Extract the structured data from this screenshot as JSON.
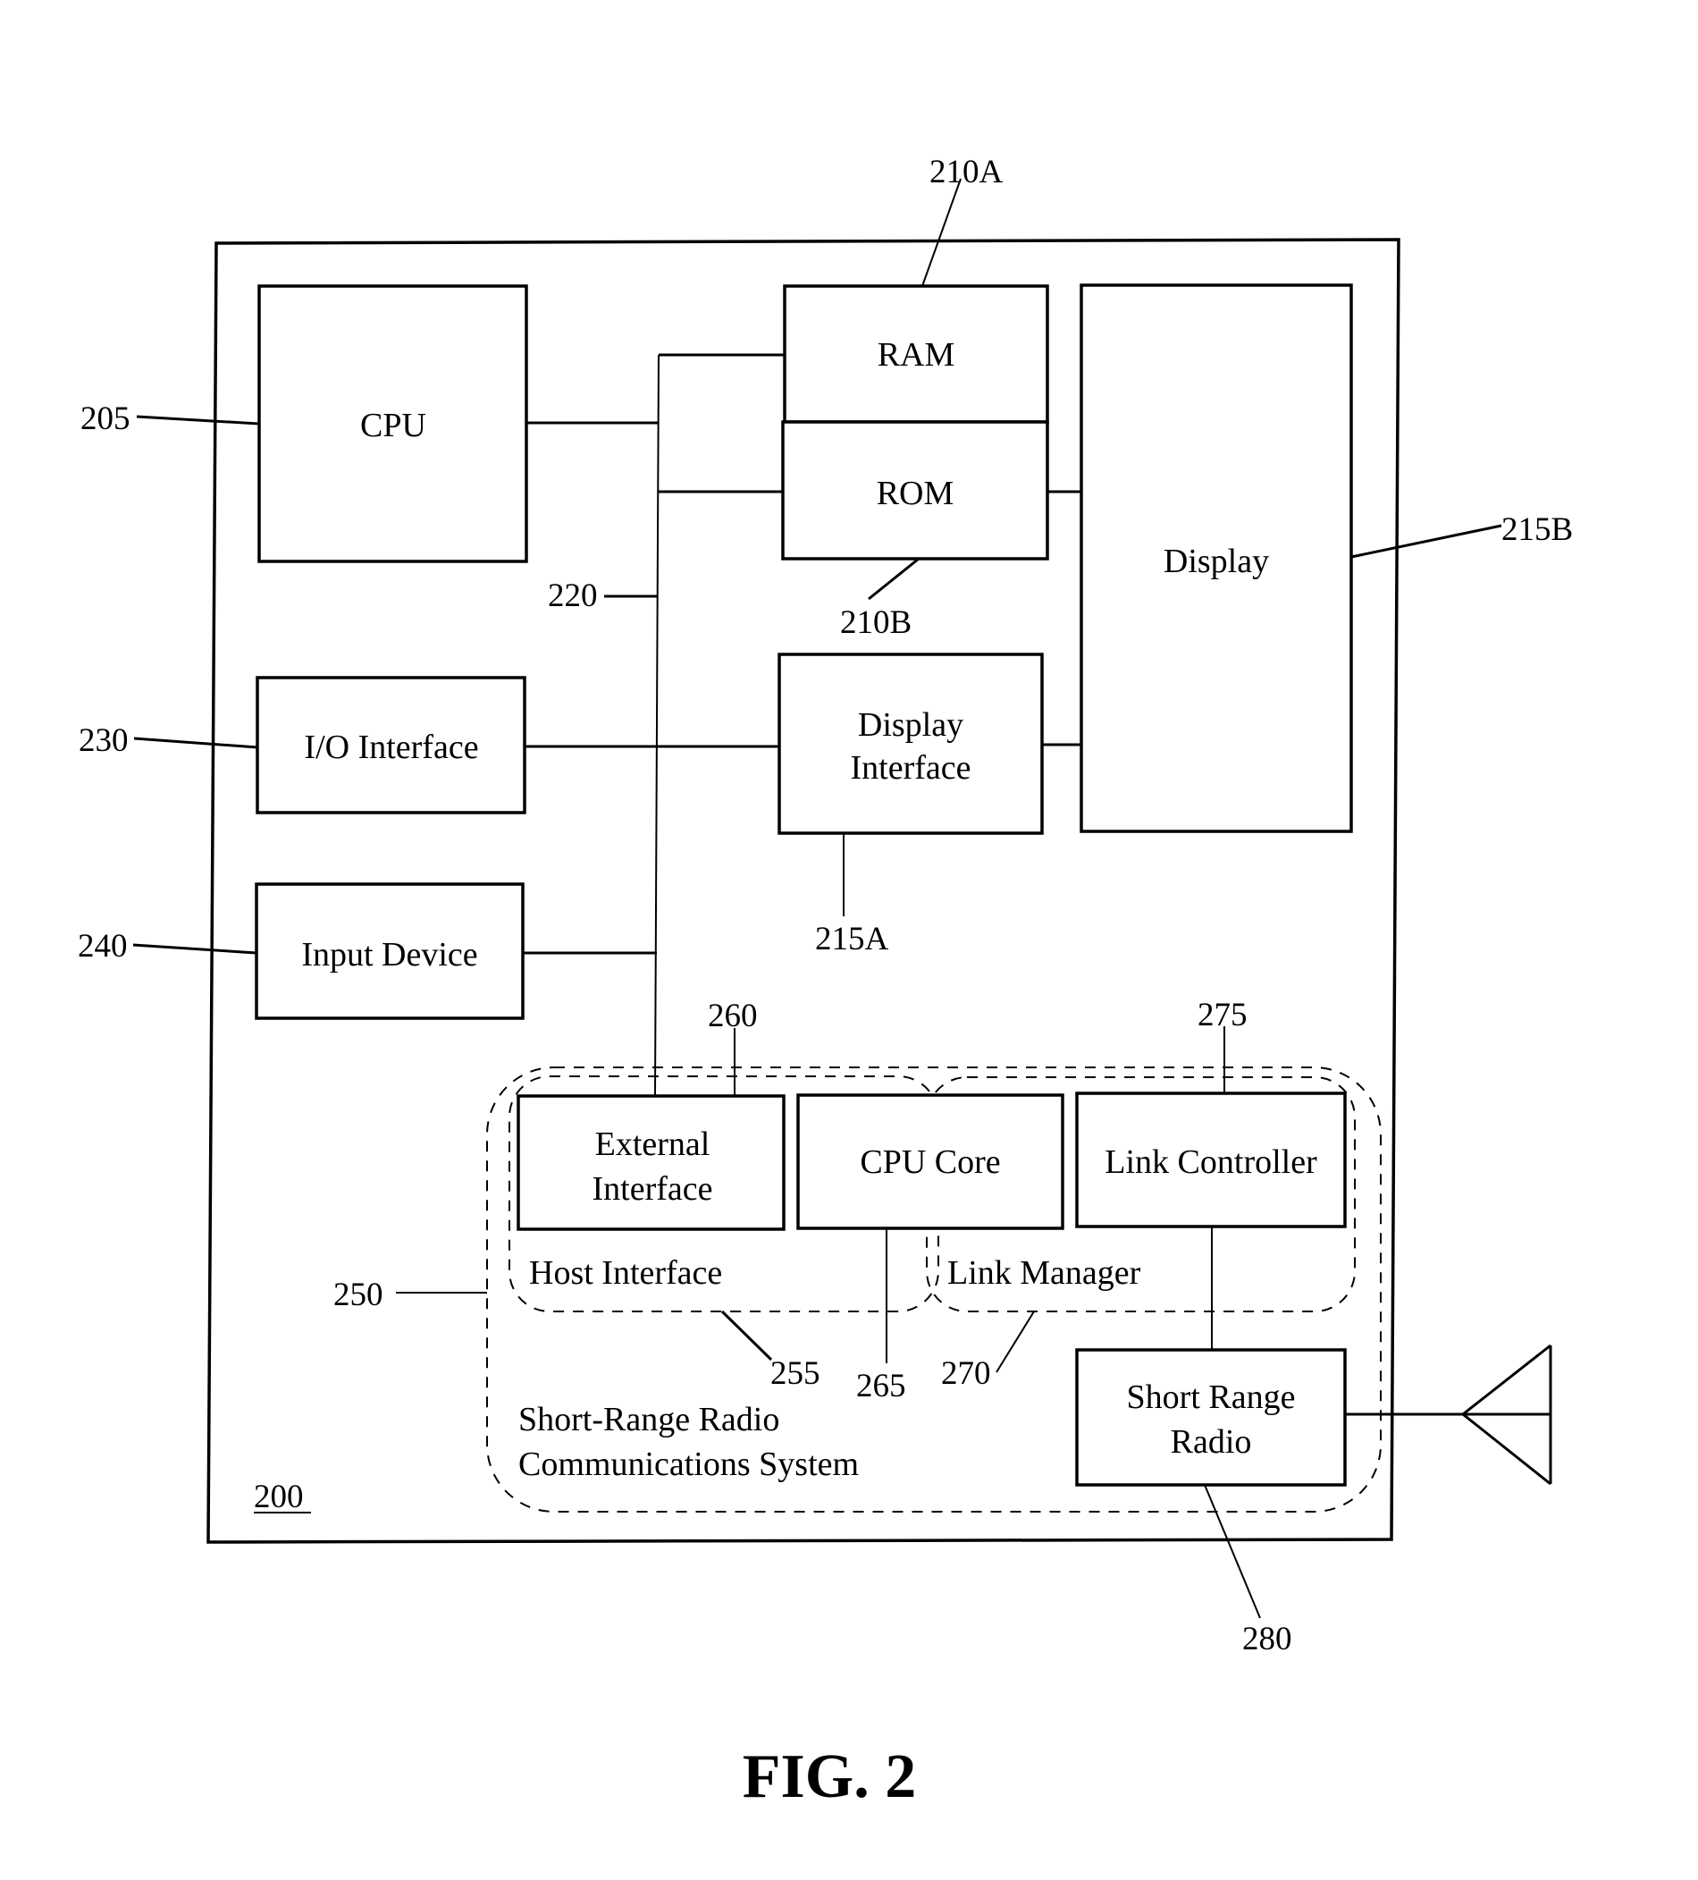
{
  "figure": {
    "caption": "FIG. 2",
    "device_ref": "200"
  },
  "blocks": {
    "cpu": {
      "label": "CPU",
      "ref": "205"
    },
    "ram": {
      "label": "RAM",
      "ref": "210A"
    },
    "rom": {
      "label": "ROM",
      "ref": "210B"
    },
    "display": {
      "label": "Display",
      "ref": "215B"
    },
    "display_interface": {
      "line1": "Display",
      "line2": "Interface",
      "ref": "215A"
    },
    "io_interface": {
      "label": "I/O Interface",
      "ref": "230"
    },
    "input_device": {
      "label": "Input Device",
      "ref": "240"
    },
    "bus": {
      "ref": "220"
    },
    "external_interface": {
      "line1": "External",
      "line2": "Interface",
      "ref": "260"
    },
    "cpu_core": {
      "label": "CPU Core",
      "label_part1": "CPU",
      "label_part2": "Core",
      "ref": "265"
    },
    "link_controller": {
      "label": "Link Controller",
      "ref": "275"
    },
    "short_range_radio": {
      "line1": "Short Range",
      "line2": "Radio",
      "ref": "280"
    }
  },
  "groups": {
    "host_interface": {
      "label": "Host Interface",
      "ref": "255"
    },
    "link_manager": {
      "label": "Link Manager",
      "ref": "270"
    },
    "radio_system": {
      "line1": "Short-Range Radio",
      "line2": "Communications System",
      "ref": "250"
    }
  },
  "icons": {
    "antenna": "antenna-icon"
  }
}
